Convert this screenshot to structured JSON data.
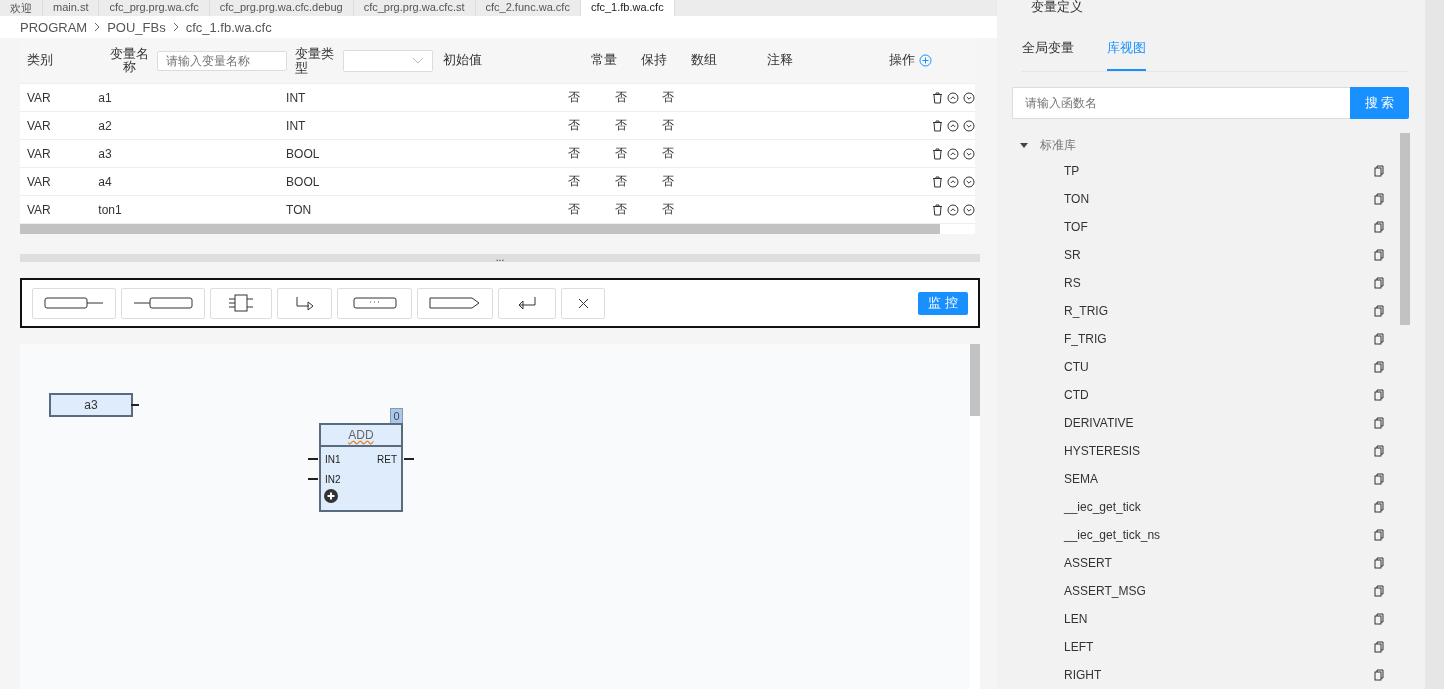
{
  "editor_tabs": [
    {
      "label": "欢迎",
      "selected": false
    },
    {
      "label": "main.st",
      "selected": false
    },
    {
      "label": "cfc_prg.prg.wa.cfc",
      "selected": false
    },
    {
      "label": "cfc_prg.prg.wa.cfc.debug",
      "selected": false
    },
    {
      "label": "cfc_prg.prg.wa.cfc.st",
      "selected": false
    },
    {
      "label": "cfc_2.func.wa.cfc",
      "selected": false
    },
    {
      "label": "cfc_1.fb.wa.cfc",
      "selected": true
    }
  ],
  "breadcrumb": [
    "PROGRAM",
    "POU_FBs",
    "cfc_1.fb.wa.cfc"
  ],
  "var_table": {
    "columns": {
      "category": "类别",
      "name": "变量名称",
      "name_placeholder": "请输入变量名称",
      "type": "变量类型",
      "initial": "初始值",
      "constant": "常量",
      "retain": "保持",
      "array": "数组",
      "comment": "注释",
      "actions": "操作"
    },
    "rows": [
      {
        "category": "VAR",
        "name": "a1",
        "type": "INT",
        "constant": "否",
        "retain": "否",
        "array": "否"
      },
      {
        "category": "VAR",
        "name": "a2",
        "type": "INT",
        "constant": "否",
        "retain": "否",
        "array": "否"
      },
      {
        "category": "VAR",
        "name": "a3",
        "type": "BOOL",
        "constant": "否",
        "retain": "否",
        "array": "否"
      },
      {
        "category": "VAR",
        "name": "a4",
        "type": "BOOL",
        "constant": "否",
        "retain": "否",
        "array": "否"
      },
      {
        "category": "VAR",
        "name": "ton1",
        "type": "TON",
        "constant": "否",
        "retain": "否",
        "array": "否"
      }
    ]
  },
  "splitter_handle": "...",
  "toolbar": {
    "tools": [
      {
        "kind": "input"
      },
      {
        "kind": "output"
      },
      {
        "kind": "box"
      },
      {
        "kind": "jump"
      },
      {
        "kind": "comment"
      },
      {
        "kind": "label"
      },
      {
        "kind": "return"
      },
      {
        "kind": "delete"
      }
    ],
    "monitor_button": "监 控"
  },
  "canvas": {
    "input_block": {
      "label": "a3"
    },
    "function_block": {
      "name": "ADD",
      "order": "0",
      "inputs": [
        "IN1",
        "IN2"
      ],
      "output": "RET"
    }
  },
  "right_panel": {
    "title": "变量定义",
    "tabs": [
      {
        "label": "全局变量",
        "selected": false
      },
      {
        "label": "库视图",
        "selected": true
      }
    ],
    "search": {
      "placeholder": "请输入函数名",
      "button": "搜 索"
    },
    "tree": {
      "label": "标准库",
      "expanded": true,
      "children": [
        "TP",
        "TON",
        "TOF",
        "SR",
        "RS",
        "R_TRIG",
        "F_TRIG",
        "CTU",
        "CTD",
        "DERIVATIVE",
        "HYSTERESIS",
        "SEMA",
        "__iec_get_tick",
        "__iec_get_tick_ns",
        "ASSERT",
        "ASSERT_MSG",
        "LEN",
        "LEFT",
        "RIGHT"
      ]
    }
  }
}
